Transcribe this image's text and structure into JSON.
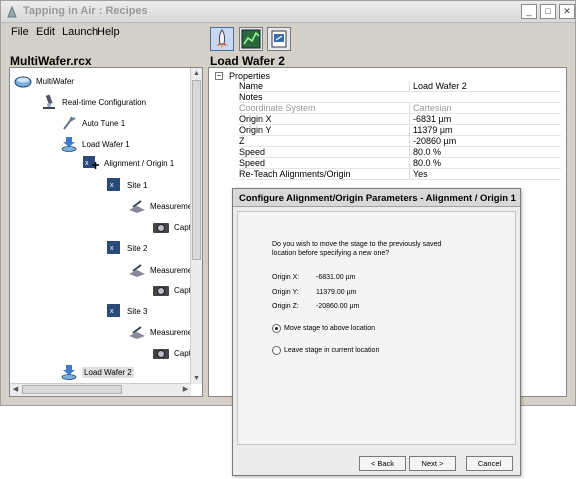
{
  "window": {
    "title": "Tapping in Air : Recipes",
    "minimize_glyph": "_",
    "maximize_glyph": "□",
    "close_glyph": "✕"
  },
  "menu": [
    "File",
    "Edit",
    "Launch",
    "Help"
  ],
  "toolbar": {
    "icons": [
      "launch-rocket-icon",
      "chart-icon",
      "export-icon"
    ]
  },
  "tree": {
    "title": "MultiWafer.rcx",
    "nodes": [
      {
        "label": "MultiWafer",
        "icon": "wafer-dish-icon"
      },
      {
        "label": "Real-time Configuration",
        "icon": "microscope-icon"
      },
      {
        "label": "Auto Tune 1",
        "icon": "tuning-fork-icon"
      },
      {
        "label": "Load Wafer 1",
        "icon": "load-wafer-icon"
      },
      {
        "label": "Alignment / Origin 1",
        "icon": "alignment-icon"
      },
      {
        "label": "Site 1",
        "icon": "site-icon"
      },
      {
        "label": "Measuremen",
        "icon": "measurement-icon"
      },
      {
        "label": "Capt",
        "icon": "camera-icon"
      },
      {
        "label": "Site 2",
        "icon": "site-icon"
      },
      {
        "label": "Measuremen",
        "icon": "measurement-icon"
      },
      {
        "label": "Capt",
        "icon": "camera-icon"
      },
      {
        "label": "Site 3",
        "icon": "site-icon"
      },
      {
        "label": "Measuremen",
        "icon": "measurement-icon"
      },
      {
        "label": "Capt",
        "icon": "camera-icon"
      },
      {
        "label": "Load Wafer 2",
        "icon": "load-wafer-icon"
      }
    ]
  },
  "properties": {
    "title": "Load Wafer 2",
    "group_label": "Properties",
    "collapse_glyph": "−",
    "rows": [
      {
        "name": "Name",
        "value": "Load Wafer 2"
      },
      {
        "name": "Notes",
        "value": ""
      },
      {
        "name": "Coordinate System",
        "value": "Cartesian"
      },
      {
        "name": "Origin X",
        "value": "-6831 µm"
      },
      {
        "name": "Origin Y",
        "value": "11379 µm"
      },
      {
        "name": "Z",
        "value": "-20860 µm"
      },
      {
        "name": "Speed",
        "value": "80.0 %"
      },
      {
        "name": "Speed",
        "value": "80.0 %"
      },
      {
        "name": "Re-Teach Alignments/Origin",
        "value": "Yes"
      }
    ]
  },
  "dialog": {
    "title": "Configure Alignment/Origin Parameters - Alignment / Origin 1",
    "question_line1": "Do you wish to move the stage to the previously saved",
    "question_line2": "location before specifying a new one?",
    "coords": [
      {
        "label": "Origin X:",
        "value": "-6831.00 µm"
      },
      {
        "label": "Origin Y:",
        "value": "11379.00 µm"
      },
      {
        "label": "Origin Z:",
        "value": "-20860.00 µm"
      }
    ],
    "option_move": "Move stage to above location",
    "option_leave": "Leave stage in current location",
    "selected_option": "move",
    "back_label": "< Back",
    "next_label": "Next >",
    "cancel_label": "Cancel"
  }
}
